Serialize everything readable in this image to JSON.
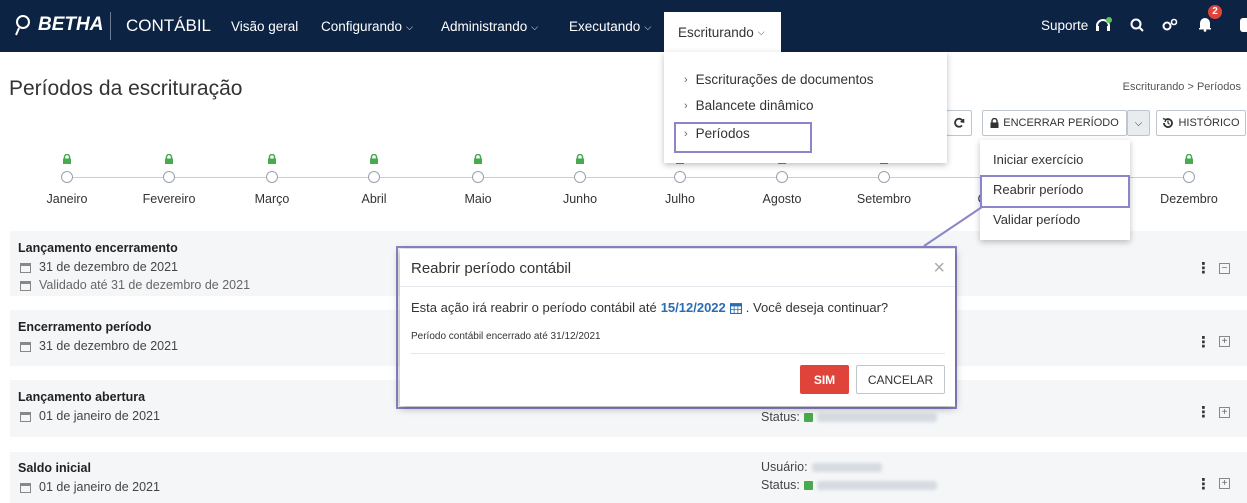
{
  "nav": {
    "brand": "BETHA",
    "product": "CONTÁBIL",
    "items": [
      {
        "label": "Visão geral",
        "has_caret": false
      },
      {
        "label": "Configurando",
        "has_caret": true
      },
      {
        "label": "Administrando",
        "has_caret": true
      },
      {
        "label": "Executando",
        "has_caret": true
      }
    ],
    "active_item": "Escriturando",
    "support_label": "Suporte",
    "notification_count": "2",
    "icons": [
      "support-icon",
      "search-icon",
      "settings-icon",
      "bell-icon"
    ]
  },
  "escriturando_menu": {
    "items": [
      "Escriturações de documentos",
      "Balancete dinâmico",
      "Períodos"
    ]
  },
  "page": {
    "title": "Períodos da escrituração",
    "breadcrumb": "Escriturando > Períodos"
  },
  "toolbar": {
    "refresh_icon": "refresh-icon",
    "close_period_label": "ENCERRAR PERÍODO",
    "history_label": "HISTÓRICO"
  },
  "period_actions_menu": {
    "items": [
      "Iniciar exercício",
      "Reabrir período",
      "Validar período"
    ]
  },
  "timeline": {
    "months": [
      "Janeiro",
      "Fevereiro",
      "Março",
      "Abril",
      "Maio",
      "Junho",
      "Julho",
      "Agosto",
      "Setembro",
      "Ou",
      "",
      "Dezembro"
    ],
    "locked": [
      true,
      true,
      true,
      true,
      true,
      true,
      true,
      true,
      true,
      false,
      false,
      true
    ]
  },
  "rows": [
    {
      "title": "Lançamento encerramento",
      "date": "31 de dezembro de 2021",
      "validated": "Validado até 31 de dezembro de 2021",
      "toggle": "−"
    },
    {
      "title": "Encerramento período",
      "date": "31 de dezembro de 2021",
      "toggle": "+"
    },
    {
      "title": "Lançamento abertura",
      "date": "01 de janeiro de 2021",
      "status_label": "Status:",
      "toggle": "+"
    },
    {
      "title": "Saldo inicial",
      "date": "01 de janeiro de 2021",
      "user_label": "Usuário:",
      "status_label": "Status:",
      "toggle": "+"
    }
  ],
  "modal": {
    "title": "Reabrir período contábil",
    "message_before": "Esta ação irá reabrir o período contábil até",
    "date": "15/12/2022",
    "message_after": ". Você deseja continuar?",
    "subtext": "Período contábil encerrado até 31/12/2021",
    "confirm_label": "SIM",
    "cancel_label": "CANCELAR"
  },
  "colors": {
    "navbar": "#0d2344",
    "accent_red": "#e0433a",
    "highlight_outline": "#8b86c9",
    "lock_green": "#49a94e",
    "date_blue": "#2a6db3"
  }
}
